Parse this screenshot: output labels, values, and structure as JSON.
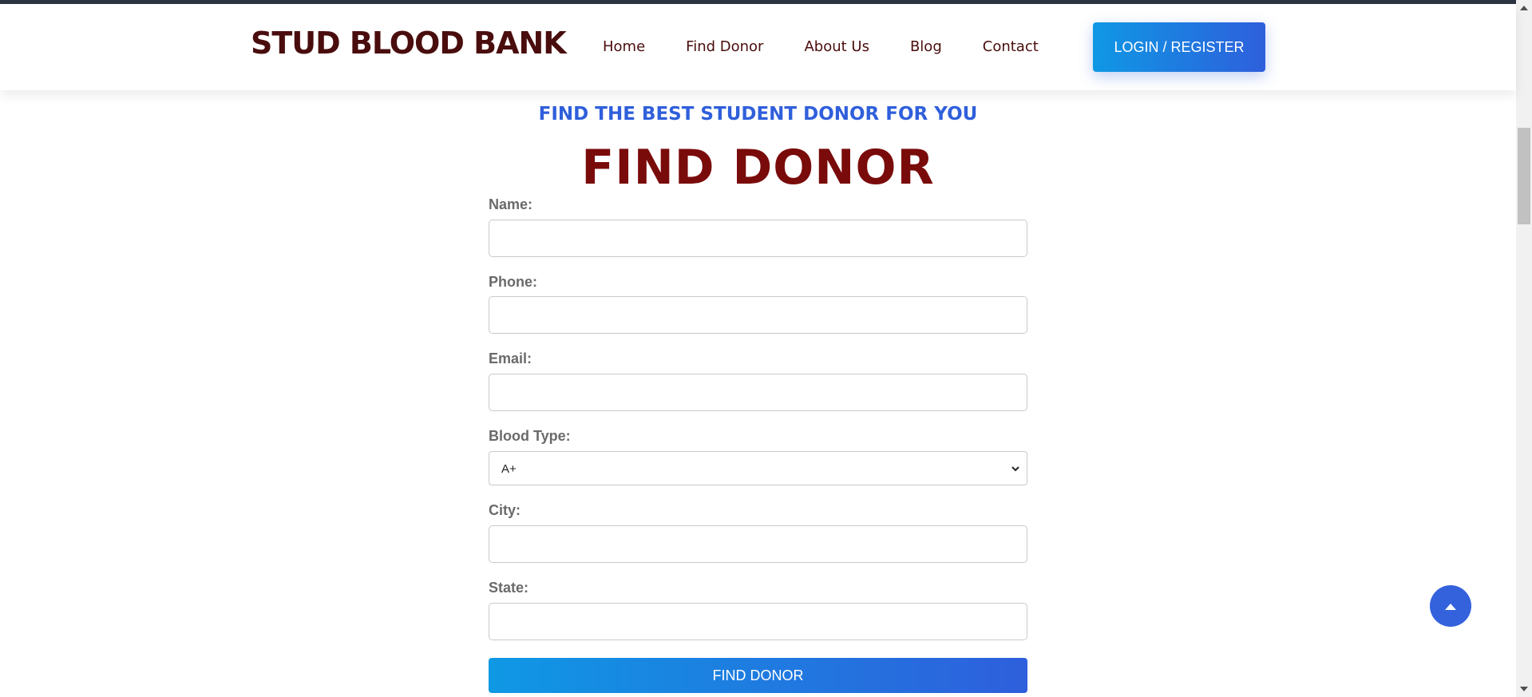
{
  "header": {
    "logo": "STUD BLOOD BANK",
    "nav": [
      "Home",
      "Find Donor",
      "About Us",
      "Blog",
      "Contact"
    ],
    "login_label": "LOGIN / REGISTER"
  },
  "hero": {
    "subtitle": "FIND THE BEST STUDENT DONOR FOR YOU",
    "title": "FIND DONOR"
  },
  "form": {
    "name_label": "Name:",
    "name_value": "",
    "phone_label": "Phone:",
    "phone_value": "",
    "email_label": "Email:",
    "email_value": "",
    "blood_type_label": "Blood Type:",
    "blood_type_value": "A+",
    "city_label": "City:",
    "city_value": "",
    "state_label": "State:",
    "state_value": "",
    "submit_label": "FIND DONOR"
  },
  "icons": {
    "scroll_top": "caret-up-icon",
    "select": "chevron-down-icon"
  },
  "colors": {
    "brand_dark": "#4a0d0d",
    "title_red": "#7a0b0b",
    "accent_blue": "#2f5fdb",
    "gradient_start": "#0f98e4",
    "gradient_end": "#2e5fdc"
  }
}
